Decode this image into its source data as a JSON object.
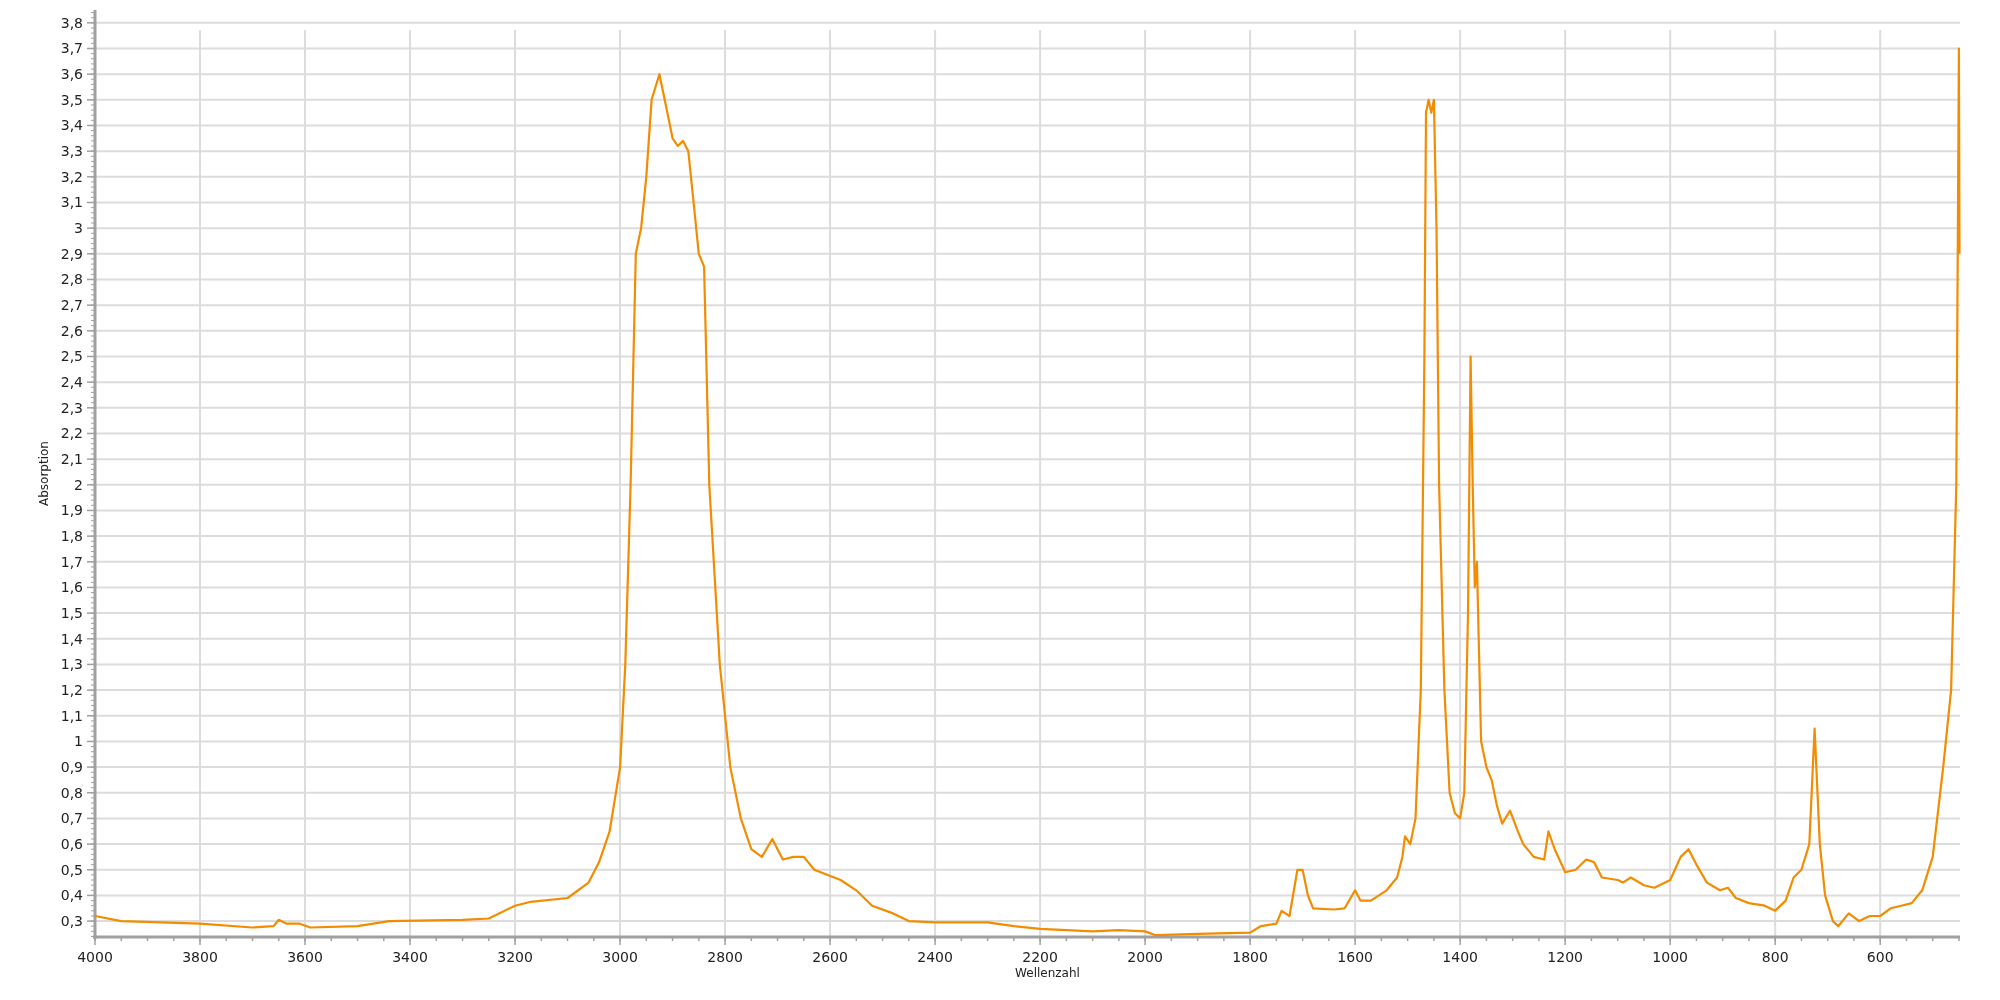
{
  "chart": {
    "chart_data": {
      "type": "line",
      "xlabel": "Wellenzahl",
      "ylabel": "Absorption",
      "grid": true,
      "xlim": [
        4000,
        448
      ],
      "ylim": [
        0.238,
        3.85
      ],
      "xticks": [
        4000,
        3800,
        3600,
        3400,
        3200,
        3000,
        2800,
        2600,
        2400,
        2200,
        2000,
        1800,
        1600,
        1400,
        1200,
        1000,
        800,
        600
      ],
      "yticks": [
        {
          "value": 0.3,
          "label": "0,3"
        },
        {
          "value": 0.4,
          "label": "0,4"
        },
        {
          "value": 0.5,
          "label": "0,5"
        },
        {
          "value": 0.6,
          "label": "0,6"
        },
        {
          "value": 0.7,
          "label": "0,7"
        },
        {
          "value": 0.8,
          "label": "0,8"
        },
        {
          "value": 0.9,
          "label": "0,9"
        },
        {
          "value": 1,
          "label": "1"
        },
        {
          "value": 1.1,
          "label": "1,1"
        },
        {
          "value": 1.2,
          "label": "1,2"
        },
        {
          "value": 1.3,
          "label": "1,3"
        },
        {
          "value": 1.4,
          "label": "1,4"
        },
        {
          "value": 1.5,
          "label": "1,5"
        },
        {
          "value": 1.6,
          "label": "1,6"
        },
        {
          "value": 1.7,
          "label": "1,7"
        },
        {
          "value": 1.8,
          "label": "1,8"
        },
        {
          "value": 1.9,
          "label": "1,9"
        },
        {
          "value": 2,
          "label": "2"
        },
        {
          "value": 2.1,
          "label": "2,1"
        },
        {
          "value": 2.2,
          "label": "2,2"
        },
        {
          "value": 2.3,
          "label": "2,3"
        },
        {
          "value": 2.4,
          "label": "2,4"
        },
        {
          "value": 2.5,
          "label": "2,5"
        },
        {
          "value": 2.6,
          "label": "2,6"
        },
        {
          "value": 2.7,
          "label": "2,7"
        },
        {
          "value": 2.8,
          "label": "2,8"
        },
        {
          "value": 2.9,
          "label": "2,9"
        },
        {
          "value": 3,
          "label": "3"
        },
        {
          "value": 3.1,
          "label": "3,1"
        },
        {
          "value": 3.2,
          "label": "3,2"
        },
        {
          "value": 3.3,
          "label": "3,3"
        },
        {
          "value": 3.4,
          "label": "3,4"
        },
        {
          "value": 3.5,
          "label": "3,5"
        },
        {
          "value": 3.6,
          "label": "3,6"
        },
        {
          "value": 3.7,
          "label": "3,7"
        },
        {
          "value": 3.8,
          "label": "3,8"
        }
      ],
      "x": [
        4000,
        3950,
        3800,
        3700,
        3660,
        3650,
        3635,
        3610,
        3590,
        3500,
        3440,
        3300,
        3250,
        3200,
        3170,
        3100,
        3060,
        3040,
        3020,
        3000,
        2990,
        2980,
        2970,
        2960,
        2950,
        2940,
        2925,
        2915,
        2900,
        2890,
        2880,
        2870,
        2860,
        2850,
        2840,
        2830,
        2810,
        2790,
        2770,
        2750,
        2730,
        2710,
        2690,
        2670,
        2650,
        2630,
        2580,
        2550,
        2520,
        2480,
        2450,
        2400,
        2300,
        2250,
        2200,
        2150,
        2100,
        2050,
        2000,
        1980,
        1900,
        1800,
        1780,
        1750,
        1740,
        1725,
        1710,
        1700,
        1690,
        1680,
        1640,
        1620,
        1600,
        1590,
        1570,
        1540,
        1520,
        1510,
        1505,
        1495,
        1485,
        1475,
        1468,
        1465,
        1460,
        1455,
        1450,
        1445,
        1440,
        1430,
        1420,
        1410,
        1400,
        1392,
        1385,
        1380,
        1376,
        1372,
        1368,
        1360,
        1350,
        1340,
        1330,
        1320,
        1305,
        1290,
        1280,
        1260,
        1240,
        1232,
        1220,
        1200,
        1180,
        1160,
        1145,
        1130,
        1100,
        1090,
        1075,
        1050,
        1030,
        1000,
        980,
        965,
        950,
        930,
        905,
        890,
        875,
        850,
        820,
        800,
        780,
        765,
        750,
        735,
        725,
        715,
        705,
        690,
        680,
        660,
        640,
        620,
        600,
        580,
        560,
        540,
        520,
        500,
        480,
        465,
        455,
        452,
        450,
        449
      ],
      "series": [
        {
          "color": "#f28c00",
          "values": [
            0.32,
            0.3,
            0.29,
            0.275,
            0.28,
            0.305,
            0.29,
            0.29,
            0.275,
            0.28,
            0.3,
            0.305,
            0.31,
            0.36,
            0.375,
            0.39,
            0.45,
            0.53,
            0.65,
            0.9,
            1.3,
            2.0,
            2.9,
            3.0,
            3.2,
            3.5,
            3.6,
            3.5,
            3.35,
            3.32,
            3.34,
            3.3,
            3.1,
            2.9,
            2.85,
            2.0,
            1.3,
            0.9,
            0.7,
            0.58,
            0.55,
            0.62,
            0.54,
            0.55,
            0.55,
            0.5,
            0.46,
            0.42,
            0.36,
            0.33,
            0.3,
            0.295,
            0.295,
            0.28,
            0.27,
            0.265,
            0.26,
            0.265,
            0.26,
            0.245,
            0.25,
            0.255,
            0.28,
            0.29,
            0.34,
            0.32,
            0.5,
            0.5,
            0.4,
            0.35,
            0.345,
            0.35,
            0.42,
            0.38,
            0.38,
            0.42,
            0.47,
            0.55,
            0.63,
            0.6,
            0.7,
            1.2,
            2.5,
            3.45,
            3.5,
            3.45,
            3.5,
            3.0,
            2.0,
            1.2,
            0.8,
            0.72,
            0.7,
            0.8,
            1.5,
            2.5,
            2.0,
            1.6,
            1.7,
            1.0,
            0.9,
            0.85,
            0.75,
            0.68,
            0.73,
            0.65,
            0.6,
            0.55,
            0.54,
            0.65,
            0.58,
            0.49,
            0.5,
            0.54,
            0.53,
            0.47,
            0.46,
            0.45,
            0.47,
            0.44,
            0.43,
            0.46,
            0.55,
            0.58,
            0.52,
            0.45,
            0.42,
            0.43,
            0.39,
            0.37,
            0.36,
            0.34,
            0.38,
            0.47,
            0.5,
            0.6,
            1.05,
            0.6,
            0.4,
            0.3,
            0.28,
            0.33,
            0.3,
            0.32,
            0.32,
            0.35,
            0.36,
            0.37,
            0.42,
            0.55,
            0.9,
            1.2,
            2.0,
            3.0,
            3.7,
            2.9
          ]
        }
      ]
    }
  }
}
